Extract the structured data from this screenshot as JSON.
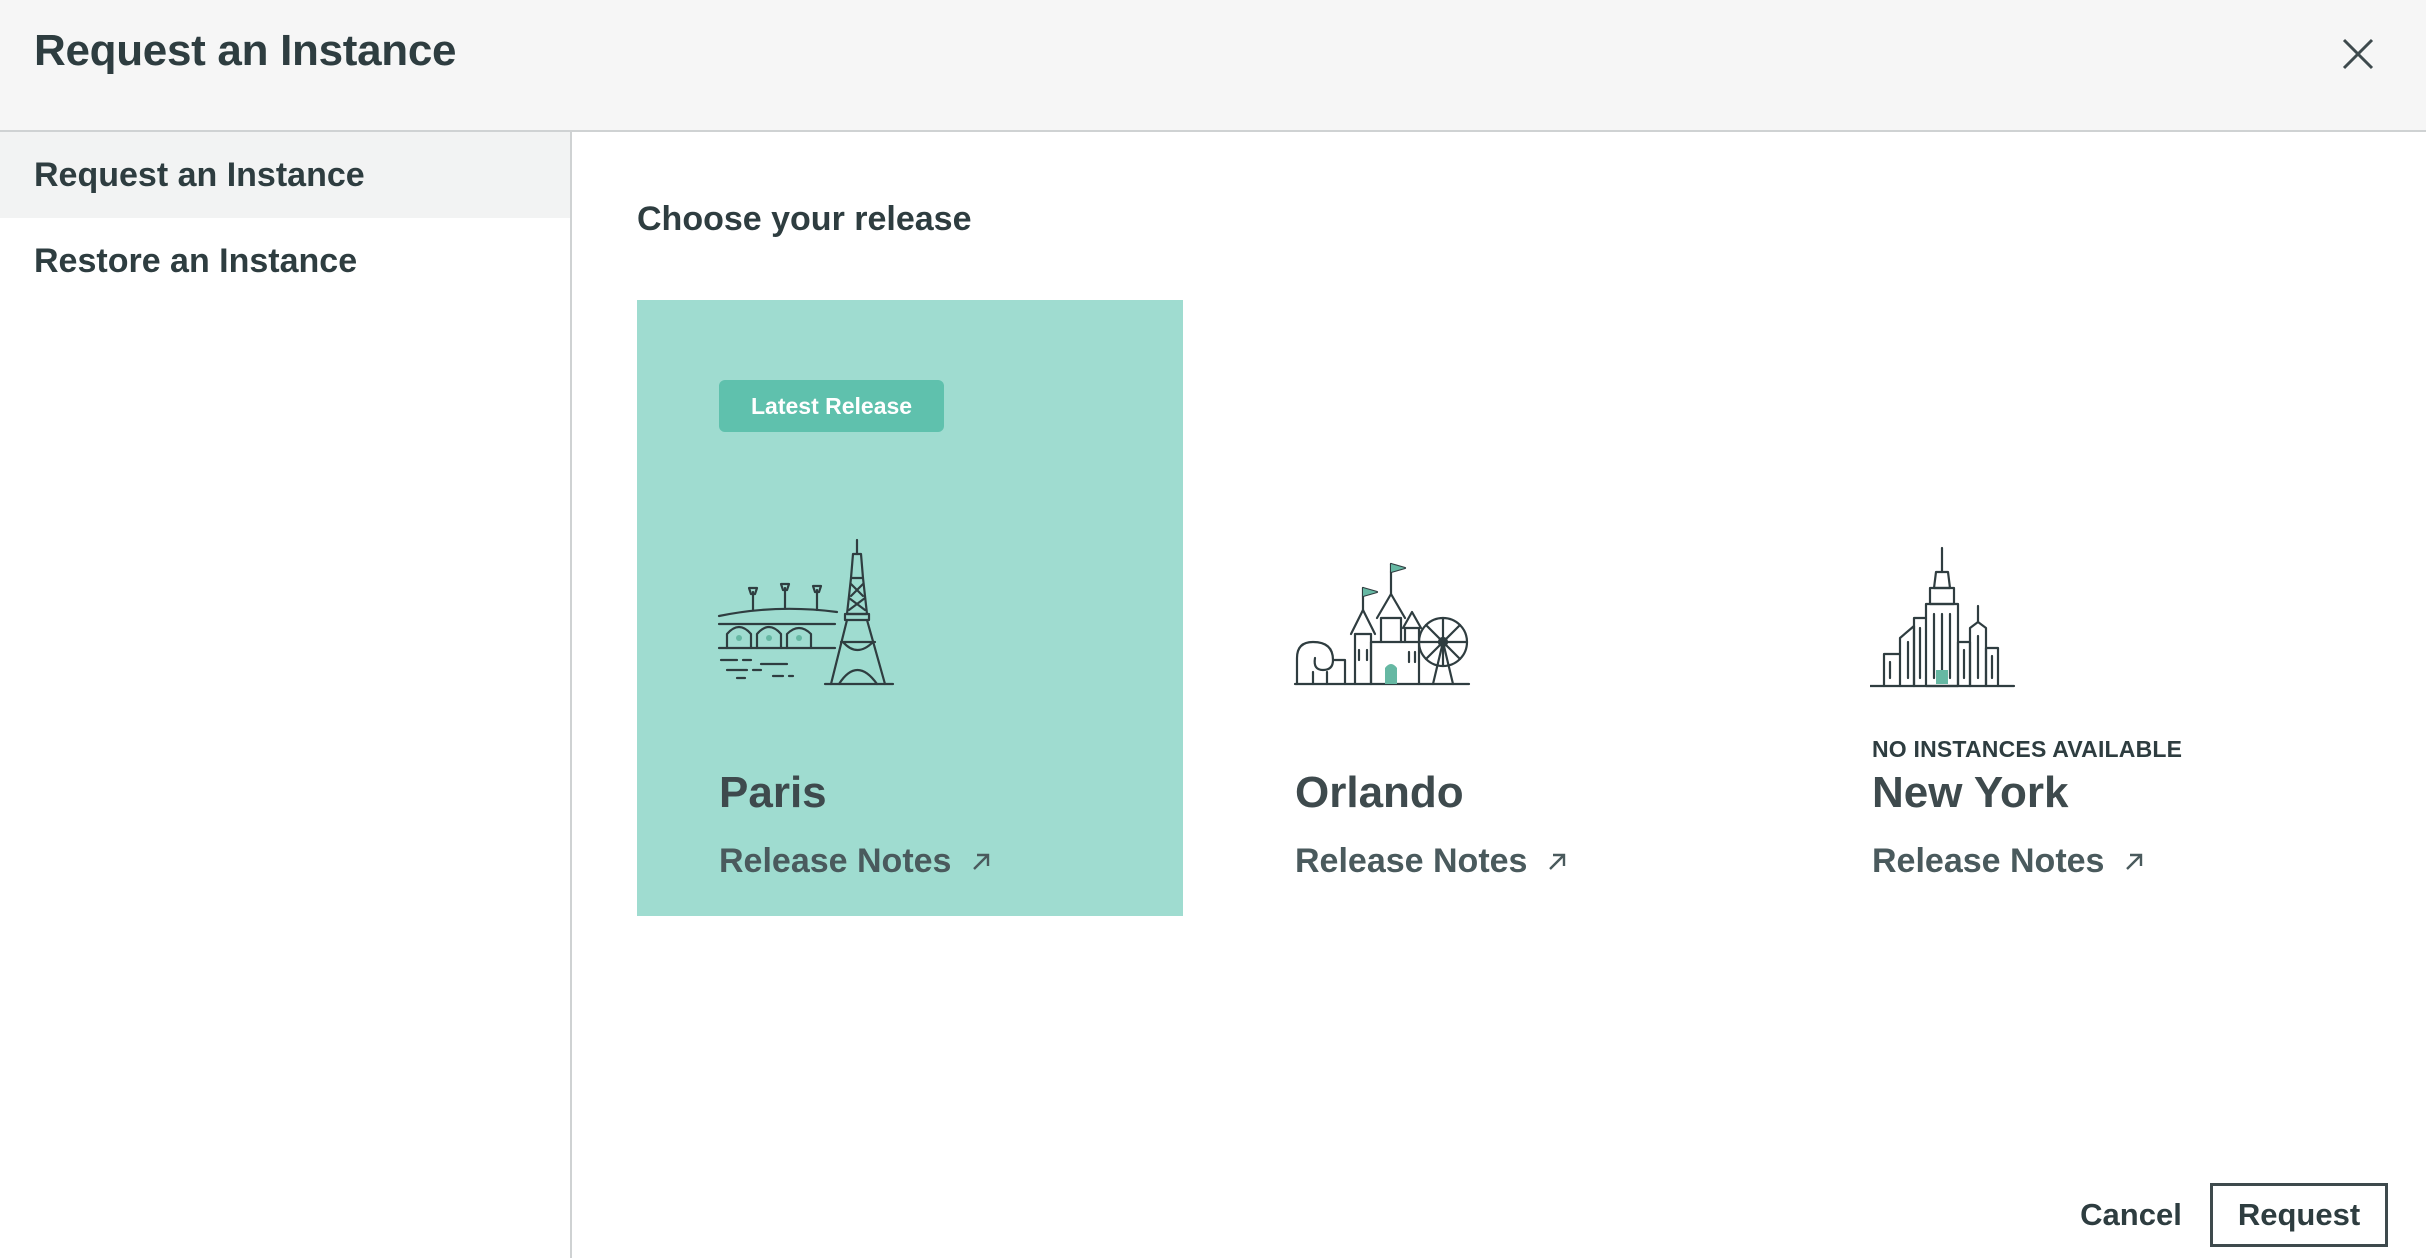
{
  "header": {
    "title": "Request an Instance",
    "close_icon": "close-icon"
  },
  "sidebar": {
    "items": [
      {
        "label": "Request an Instance",
        "active": true
      },
      {
        "label": "Restore an Instance",
        "active": false
      }
    ]
  },
  "main": {
    "section_title": "Choose your release",
    "releases": [
      {
        "city": "Paris",
        "badge": "Latest Release",
        "availability": "",
        "notes_label": "Release Notes",
        "selected": true,
        "illustration": "paris-eiffel-tower-icon"
      },
      {
        "city": "Orlando",
        "badge": "",
        "availability": "",
        "notes_label": "Release Notes",
        "selected": false,
        "illustration": "orlando-castle-icon"
      },
      {
        "city": "New York",
        "badge": "",
        "availability": "NO INSTANCES AVAILABLE",
        "notes_label": "Release Notes",
        "selected": false,
        "illustration": "new-york-skyline-icon"
      }
    ]
  },
  "footer": {
    "cancel_label": "Cancel",
    "request_label": "Request"
  },
  "colors": {
    "selected_card": "#9fdcd0",
    "badge": "#5fc1ad",
    "text": "#2e3d40",
    "header_bg": "#f6f6f6",
    "accent_green": "#66b8a3"
  }
}
